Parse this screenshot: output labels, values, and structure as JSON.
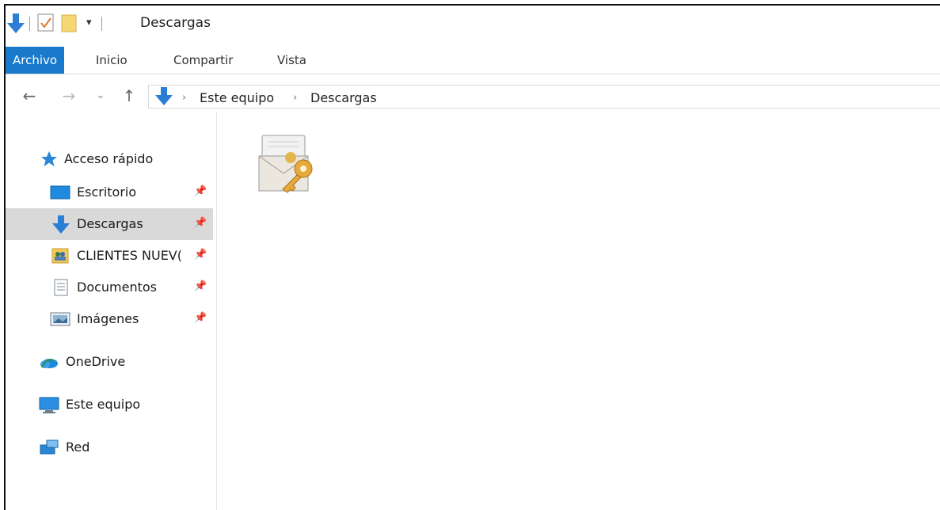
{
  "window": {
    "title": "Descargas"
  },
  "ribbon": {
    "tabs": [
      {
        "label": "Archivo",
        "active": true
      },
      {
        "label": "Inicio"
      },
      {
        "label": "Compartir"
      },
      {
        "label": "Vista"
      }
    ]
  },
  "address": {
    "crumbs": [
      "Este equipo",
      "Descargas"
    ]
  },
  "nav": {
    "quick_access": "Acceso rápido",
    "pinned": [
      {
        "label": "Escritorio",
        "icon": "desktop-icon"
      },
      {
        "label": "Descargas",
        "icon": "download-arrow-icon",
        "selected": true
      },
      {
        "label": "CLIENTES NUEV(",
        "icon": "contacts-folder-icon"
      },
      {
        "label": "Documentos",
        "icon": "documents-icon"
      },
      {
        "label": "Imágenes",
        "icon": "pictures-icon"
      }
    ],
    "onedrive": "OneDrive",
    "this_pc": "Este equipo",
    "network": "Red"
  },
  "content": {
    "files": [
      {
        "icon": "certificate-envelope-key-icon"
      }
    ]
  },
  "colors": {
    "accent": "#1979ca",
    "selected_bg": "#d9d9d9"
  }
}
